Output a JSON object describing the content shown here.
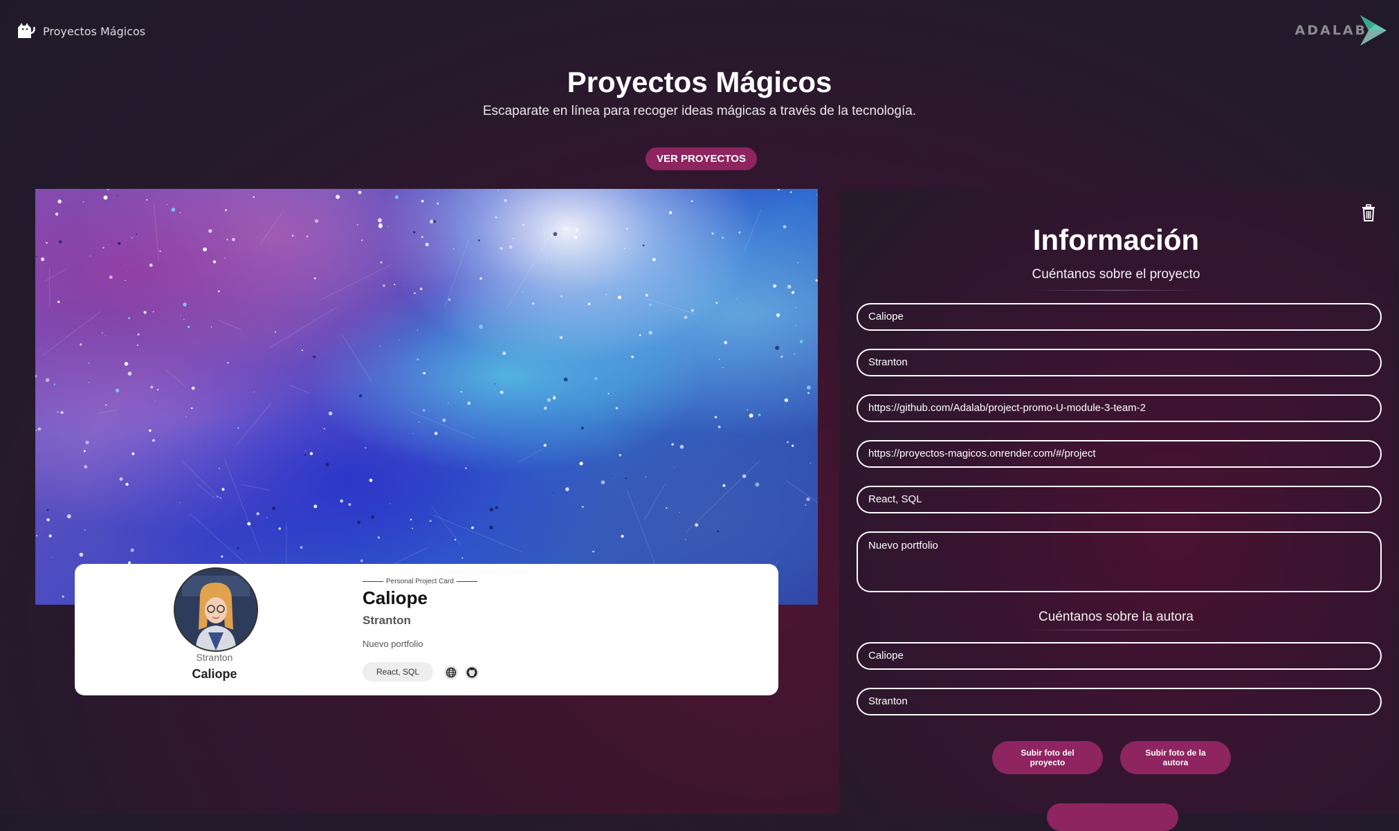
{
  "header": {
    "brand_label": "Proyectos Mágicos",
    "brand_icon": "cat-icon",
    "partner_logo_text": "ADALAB"
  },
  "hero": {
    "title": "Proyectos Mágicos",
    "subtitle": "Escaparate en línea para recoger ideas mágicas a través de la tecnología.",
    "view_projects_button": "VER PROYECTOS"
  },
  "card": {
    "tag": "Personal Project Card",
    "project_name": "Caliope",
    "slogan": "Stranton",
    "description": "Nuevo portfolio",
    "technologies": "React, SQL",
    "author_job": "Stranton",
    "author_name": "Caliope",
    "icons": [
      "globe-icon",
      "github-icon"
    ]
  },
  "form": {
    "title": "Información",
    "project_section_title": "Cuéntanos sobre el proyecto",
    "project_fields": [
      {
        "value": "Caliope"
      },
      {
        "value": "Stranton"
      },
      {
        "value": "https://github.com/Adalab/project-promo-U-module-3-team-2"
      },
      {
        "value": "https://proyectos-magicos.onrender.com/#/project"
      },
      {
        "value": "React, SQL"
      },
      {
        "value": "Nuevo portfolio"
      }
    ],
    "author_section_title": "Cuéntanos sobre la autora",
    "author_fields": [
      {
        "value": "Caliope"
      },
      {
        "value": "Stranton"
      }
    ],
    "upload_project_photo": "Subir foto del proyecto",
    "upload_author_photo": "Subir foto de la autora"
  },
  "colors": {
    "accent": "#8e2460",
    "background": "#2a1a2e"
  }
}
